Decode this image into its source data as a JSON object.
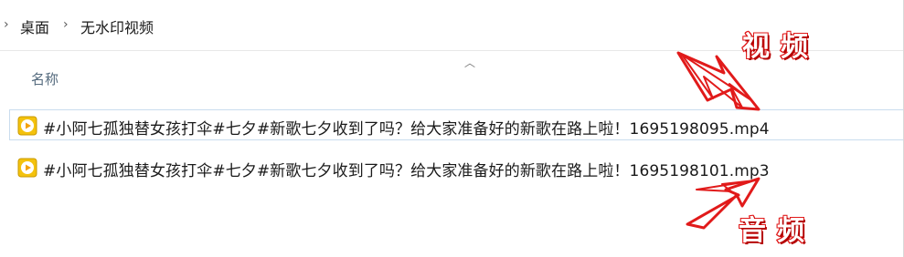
{
  "breadcrumb": {
    "items": [
      "桌面",
      "无水印视频"
    ]
  },
  "column": {
    "name_header": "名称"
  },
  "files": [
    {
      "name": "#小阿七孤独替女孩打伞#七夕#新歌七夕收到了吗？给大家准备好的新歌在路上啦！1695198095.mp4",
      "icon": "media-play-icon",
      "selected": true
    },
    {
      "name": "#小阿七孤独替女孩打伞#七夕#新歌七夕收到了吗？给大家准备好的新歌在路上啦！1695198101.mp3",
      "icon": "media-play-icon",
      "selected": false
    }
  ],
  "annotations": {
    "video_label": "视频",
    "audio_label": "音频"
  },
  "colors": {
    "annotation_red": "#e11a1a",
    "icon_yellow": "#f4c20d",
    "selection_border": "#c9dcee",
    "header_text": "#556b7e"
  }
}
